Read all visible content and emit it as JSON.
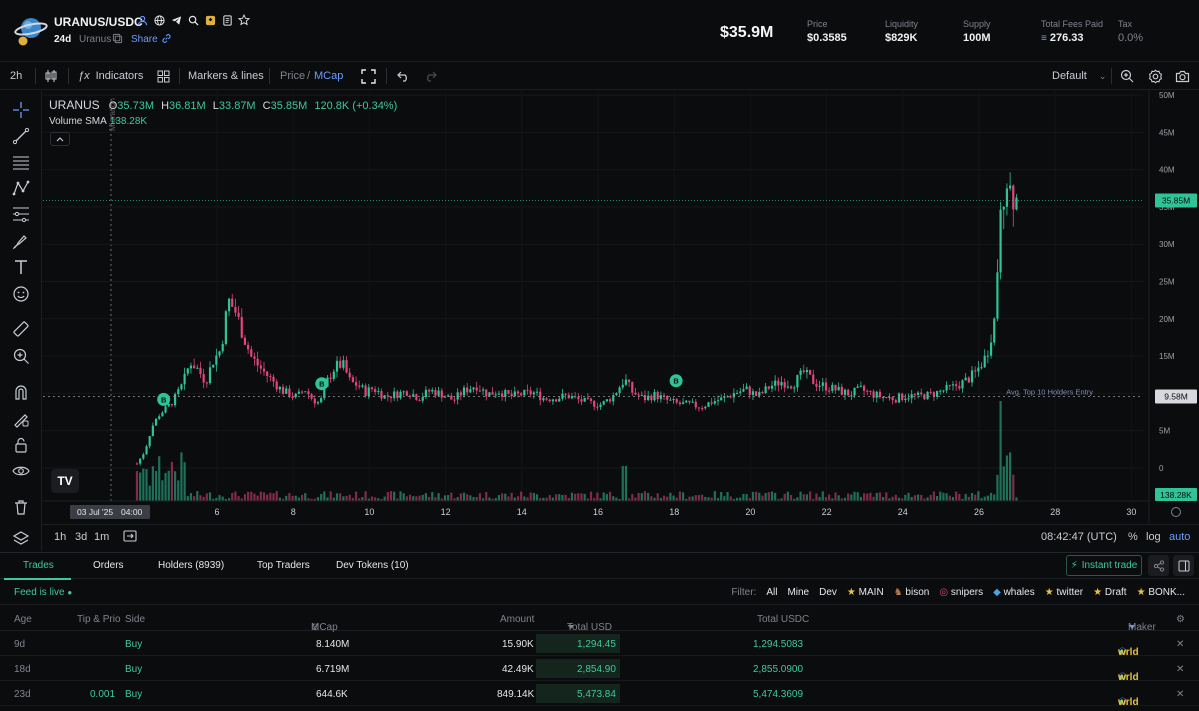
{
  "header": {
    "pair": "URANUS/USDC",
    "age": "24d",
    "ticker": "Uranus",
    "share_label": "Share",
    "market_cap": "$35.9M",
    "stats": [
      {
        "label": "Price",
        "value": "$0.3585"
      },
      {
        "label": "Liquidity",
        "value": "$829K"
      },
      {
        "label": "Supply",
        "value": "100M"
      },
      {
        "label": "Total Fees Paid",
        "value": "276.33"
      },
      {
        "label": "Tax",
        "value": "0.0%"
      }
    ]
  },
  "toolbar": {
    "interval": "2h",
    "indicators_label": "Indicators",
    "markers_label": "Markers & lines",
    "price_label": "Price",
    "slash": "/",
    "mcap_label": "MCap",
    "layout_label": "Default"
  },
  "legend": {
    "symbol": "URANUS",
    "o_label": "O",
    "o_value": "35.73M",
    "h_label": "H",
    "h_value": "36.81M",
    "l_label": "L",
    "l_value": "33.87M",
    "c_label": "C",
    "c_value": "35.85M",
    "change": "120.8K (+0.34%)",
    "volume_label": "Volume SMA",
    "volume_value": "138.28K"
  },
  "chart_data": {
    "type": "candlestick",
    "y_axis_ticks": [
      "50M",
      "45M",
      "40M",
      "35M",
      "30M",
      "25M",
      "20M",
      "15M",
      "10M",
      "5M",
      "0"
    ],
    "ylim": [
      0,
      50000000
    ],
    "x_axis_ticks": [
      "03 Jul '25",
      "04:00",
      "6",
      "8",
      "10",
      "12",
      "14",
      "16",
      "18",
      "20",
      "22",
      "24",
      "26",
      "28",
      "30"
    ],
    "last_price_label": "35.85M",
    "reference_line_label": "Avg. Top 10 Holders Entry",
    "reference_line_value": "9.58M",
    "volume_label": "138.28K",
    "vertical_marker": "Migration",
    "markers": [
      "B",
      "B",
      "B"
    ],
    "series_points": [
      [
        3.9,
        0.6
      ],
      [
        4.1,
        2.2
      ],
      [
        4.3,
        5.6
      ],
      [
        4.5,
        7.3
      ],
      [
        4.7,
        8.1
      ],
      [
        4.9,
        9.4
      ],
      [
        5.1,
        11.2
      ],
      [
        5.3,
        14.3
      ],
      [
        5.5,
        13.2
      ],
      [
        5.7,
        11.6
      ],
      [
        5.9,
        14.4
      ],
      [
        6.1,
        15.9
      ],
      [
        6.3,
        22.5
      ],
      [
        6.5,
        20.8
      ],
      [
        6.7,
        17.6
      ],
      [
        6.9,
        14.9
      ],
      [
        7.1,
        13.6
      ],
      [
        7.3,
        12.5
      ],
      [
        7.5,
        11.5
      ],
      [
        7.7,
        10.4
      ],
      [
        7.9,
        9.9
      ],
      [
        8.1,
        9.5
      ],
      [
        8.3,
        10.6
      ],
      [
        8.5,
        9.3
      ],
      [
        8.7,
        8.6
      ],
      [
        8.9,
        11.7
      ],
      [
        9.1,
        13.6
      ],
      [
        9.3,
        13.9
      ],
      [
        9.5,
        11.5
      ],
      [
        9.7,
        11.1
      ],
      [
        9.9,
        10.2
      ],
      [
        10.1,
        10.7
      ],
      [
        10.4,
        9.6
      ],
      [
        10.7,
        9.9
      ],
      [
        11,
        10.3
      ],
      [
        11.3,
        9.4
      ],
      [
        11.6,
        10.4
      ],
      [
        11.9,
        9.9
      ],
      [
        12.2,
        9.1
      ],
      [
        12.5,
        10.4
      ],
      [
        12.8,
        11.1
      ],
      [
        13.1,
        9.9
      ],
      [
        13.4,
        10.3
      ],
      [
        13.7,
        9.6
      ],
      [
        14,
        9.9
      ],
      [
        14.3,
        10.1
      ],
      [
        14.6,
        9.3
      ],
      [
        14.9,
        9.4
      ],
      [
        15.2,
        9.7
      ],
      [
        15.5,
        9.1
      ],
      [
        15.8,
        8.7
      ],
      [
        16.1,
        8.5
      ],
      [
        16.4,
        9.7
      ],
      [
        16.7,
        11.9
      ],
      [
        16.9,
        10.2
      ],
      [
        17.2,
        9.3
      ],
      [
        17.5,
        9.8
      ],
      [
        17.8,
        9.1
      ],
      [
        18.1,
        8.6
      ],
      [
        18.4,
        8.5
      ],
      [
        18.7,
        8.2
      ],
      [
        19,
        8.9
      ],
      [
        19.3,
        9.3
      ],
      [
        19.6,
        10.1
      ],
      [
        19.9,
        10.5
      ],
      [
        20.2,
        9.6
      ],
      [
        20.5,
        10.9
      ],
      [
        20.8,
        11.6
      ],
      [
        21.1,
        11.2
      ],
      [
        21.4,
        12.8
      ],
      [
        21.7,
        11.4
      ],
      [
        22,
        10.9
      ],
      [
        22.3,
        10.4
      ],
      [
        22.6,
        9.9
      ],
      [
        22.9,
        10.5
      ],
      [
        23.2,
        9.9
      ],
      [
        23.5,
        9.5
      ],
      [
        23.8,
        9.3
      ],
      [
        24.1,
        9.7
      ],
      [
        24.4,
        9.6
      ],
      [
        24.7,
        9.8
      ],
      [
        25,
        10.3
      ],
      [
        25.3,
        10.8
      ],
      [
        25.6,
        11.5
      ],
      [
        25.9,
        12.7
      ],
      [
        26.2,
        15.1
      ],
      [
        26.4,
        19.8
      ],
      [
        26.55,
        32.4
      ],
      [
        26.7,
        39.4
      ],
      [
        26.85,
        36.8
      ],
      [
        27,
        35.85
      ]
    ]
  },
  "timeframes": {
    "tf1": "1h",
    "tf2": "3d",
    "tf3": "1m",
    "clock": "08:42:47 (UTC)",
    "percent": "%",
    "log": "log",
    "auto": "auto"
  },
  "tabs": {
    "trades": "Trades",
    "orders": "Orders",
    "holders": "Holders (8939)",
    "top_traders": "Top Traders",
    "dev_tokens": "Dev Tokens (10)",
    "instant_trade": "Instant trade"
  },
  "feed": {
    "status": "Feed is live",
    "filter_label": "Filter:",
    "filters": [
      "All",
      "Mine",
      "Dev",
      "MAIN",
      "bison",
      "snipers",
      "whales",
      "twitter",
      "Draft",
      "BONK..."
    ]
  },
  "table": {
    "headers": {
      "age": "Age",
      "tip": "Tip & Prio",
      "side": "Side",
      "mcap": "MCap",
      "amount": "Amount",
      "total_usd": "Total USD",
      "total_usdc": "Total USDC",
      "maker": "Maker"
    },
    "rows": [
      {
        "age": "9d",
        "tip": "",
        "side": "Buy",
        "mcap": "8.140M",
        "amount": "15.90K",
        "total_usd": "1,294.45",
        "total_usdc": "1,294.5083",
        "maker": "wrld"
      },
      {
        "age": "18d",
        "tip": "",
        "side": "Buy",
        "mcap": "6.719M",
        "amount": "42.49K",
        "total_usd": "2,854.90",
        "total_usdc": "2,855.0900",
        "maker": "wrld"
      },
      {
        "age": "23d",
        "tip": "0.001",
        "side": "Buy",
        "mcap": "644.6K",
        "amount": "849.14K",
        "total_usd": "5,473.84",
        "total_usdc": "5,474.3609",
        "maker": "wrld"
      }
    ]
  },
  "colors": {
    "up": "#2ec495",
    "down": "#e4457a",
    "accent": "#3ec99a",
    "link": "#6e9cff"
  }
}
